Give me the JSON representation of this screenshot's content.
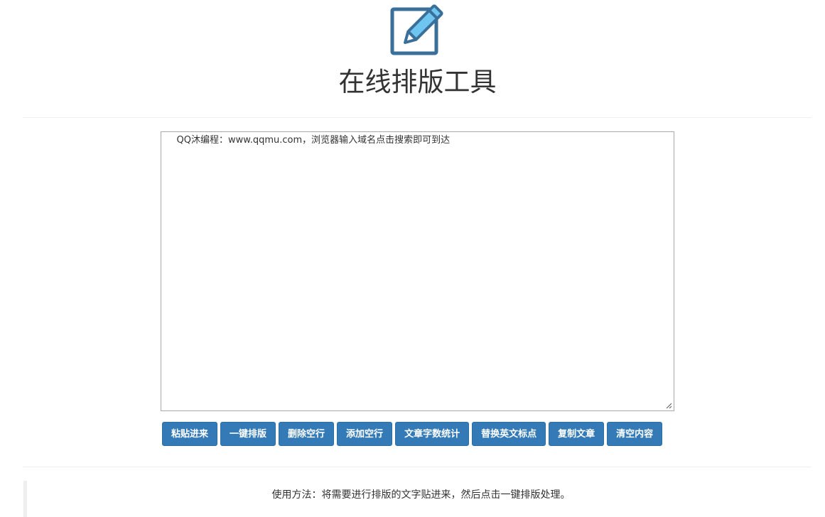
{
  "header": {
    "logo_icon": "pencil-square-icon",
    "title": "在线排版工具"
  },
  "editor": {
    "content": "    QQ沐编程：www.qqmu.com，浏览器输入域名点击搜索即可到达"
  },
  "toolbar": {
    "buttons": [
      {
        "label": "粘贴进来"
      },
      {
        "label": "一键排版"
      },
      {
        "label": "删除空行"
      },
      {
        "label": "添加空行"
      },
      {
        "label": "文章字数统计"
      },
      {
        "label": "替换英文标点"
      },
      {
        "label": "复制文章"
      },
      {
        "label": "清空内容"
      }
    ]
  },
  "usage": {
    "text": "使用方法：将需要进行排版的文字贴进来，然后点击一键排版处理。"
  },
  "colors": {
    "button_bg": "#337ab7",
    "button_border": "#2e6da4",
    "logo_stroke": "#3a6f9a",
    "logo_fill": "#6ec6f0"
  }
}
